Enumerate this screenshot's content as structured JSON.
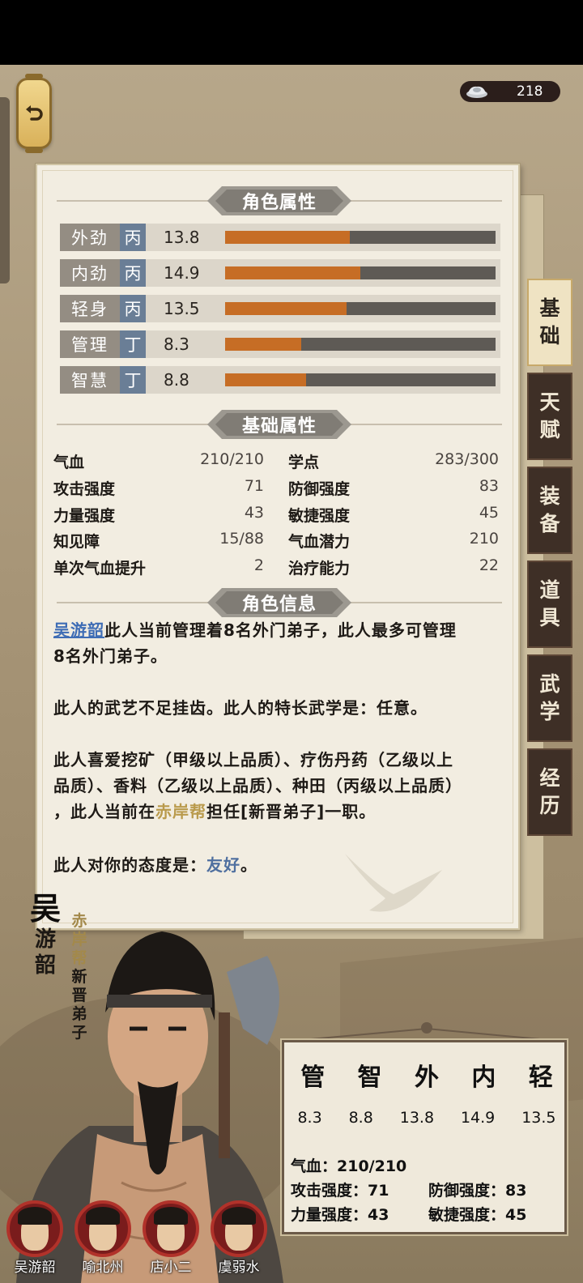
{
  "currency": {
    "icon": "silver-ingot-icon",
    "amount": "218"
  },
  "sections": {
    "attributes_title": "角色属性",
    "basic_title": "基础属性",
    "info_title": "角色信息"
  },
  "attributes": [
    {
      "name": "外劲",
      "grade": "丙",
      "value": "13.8",
      "progress": 0.46
    },
    {
      "name": "内劲",
      "grade": "丙",
      "value": "14.9",
      "progress": 0.5
    },
    {
      "name": "轻身",
      "grade": "丙",
      "value": "13.5",
      "progress": 0.45
    },
    {
      "name": "管理",
      "grade": "丁",
      "value": "8.3",
      "progress": 0.28
    },
    {
      "name": "智慧",
      "grade": "丁",
      "value": "8.8",
      "progress": 0.3
    }
  ],
  "basic_stats": [
    {
      "label": "气血",
      "value": "210/210"
    },
    {
      "label": "学点",
      "value": "283/300"
    },
    {
      "label": "攻击强度",
      "value": "71"
    },
    {
      "label": "防御强度",
      "value": "83"
    },
    {
      "label": "力量强度",
      "value": "43"
    },
    {
      "label": "敏捷强度",
      "value": "45"
    },
    {
      "label": "知见障",
      "value": "15/88"
    },
    {
      "label": "气血潜力",
      "value": "210"
    },
    {
      "label": "单次气血提升",
      "value": "2"
    },
    {
      "label": "治疗能力",
      "value": "22"
    }
  ],
  "info": {
    "p1_name": "吴游韶",
    "p1_line1_rest": "此人当前管理着8名外门弟子，此人最多可管理",
    "p1_line2": "8名外门弟子。",
    "p2": "此人的武艺不足挂齿。此人的特长武学是：任意。",
    "p3_line1": "此人喜爱挖矿（甲级以上品质）、疗伤丹药（乙级以上",
    "p3_line2": "品质）、香料（乙级以上品质）、种田（丙级以上品质）",
    "p3_line3_a": "，此人当前在",
    "p3_sect": "赤岸帮",
    "p3_line3_b": "担任[新晋弟子]一职。",
    "p4_a": "此人对你的态度是：",
    "p4_attitude": "友好",
    "p4_end": "。"
  },
  "side_tabs": [
    {
      "chars": [
        "基",
        "础"
      ],
      "active": true
    },
    {
      "chars": [
        "天",
        "赋"
      ],
      "active": false
    },
    {
      "chars": [
        "装",
        "备"
      ],
      "active": false
    },
    {
      "chars": [
        "道",
        "具"
      ],
      "active": false
    },
    {
      "chars": [
        "武",
        "学"
      ],
      "active": false
    },
    {
      "chars": [
        "经",
        "历"
      ],
      "active": false
    }
  ],
  "character": {
    "name_chars": [
      "吴",
      "游",
      "韶"
    ],
    "sect_chars": [
      "赤",
      "岸",
      "帮"
    ],
    "role_chars": [
      "新",
      "晋",
      "弟",
      "子"
    ]
  },
  "card": {
    "heads": [
      "管",
      "智",
      "外",
      "内",
      "轻"
    ],
    "values": [
      "8.3",
      "8.8",
      "13.8",
      "14.9",
      "13.5"
    ],
    "hp": "气血：210/210",
    "atk": "攻击强度：71",
    "def": "防御强度：83",
    "str": "力量强度：43",
    "agi": "敏捷强度：45"
  },
  "roster": [
    {
      "name": "吴游韶"
    },
    {
      "name": "喻北州"
    },
    {
      "name": "店小二"
    },
    {
      "name": "虞弱水"
    }
  ],
  "colors": {
    "bar_fill": "#c66d25",
    "bar_track": "#5e5a55",
    "grade_bg": "#6a7e96",
    "tab_dark": "#3e2f26",
    "link_blue": "#3f6db5",
    "sect_gold": "#b99a4c"
  }
}
